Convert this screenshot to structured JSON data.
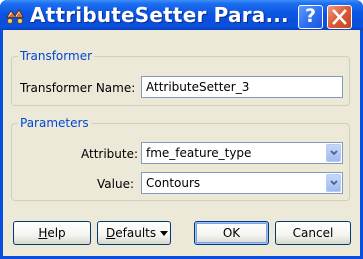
{
  "window": {
    "title": "AttributeSetter Para...",
    "help_glyph": "?",
    "close_glyph": "close-x"
  },
  "transformer_group": {
    "legend": "Transformer",
    "name_label": "Transformer Name:",
    "name_value": "AttributeSetter_3"
  },
  "parameters_group": {
    "legend": "Parameters",
    "attribute_label": "Attribute:",
    "attribute_value": "fme_feature_type",
    "value_label": "Value:",
    "value_value": "Contours"
  },
  "buttons": {
    "help": {
      "prefix": "",
      "mnemonic": "H",
      "rest": "elp"
    },
    "defaults": {
      "prefix": "",
      "mnemonic": "D",
      "rest": "efaults"
    },
    "ok": "OK",
    "cancel": "Cancel"
  },
  "icons": {
    "app": "fme-transformer-icon",
    "help": "help-icon",
    "close": "close-icon",
    "dropdown": "chevron-down-icon"
  },
  "colors": {
    "title_bar": "#0a55e3",
    "close_button": "#d95a36",
    "legend_text": "#0046d5",
    "dialog_face": "#ece9d8"
  }
}
